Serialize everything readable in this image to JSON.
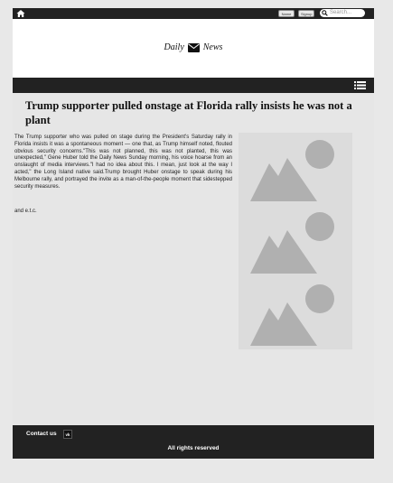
{
  "topbar": {
    "button1_label": "Name",
    "button2_label": "Signup",
    "search_placeholder": "Search...",
    "icons": [
      "home-icon",
      "search-icon"
    ]
  },
  "brand": {
    "left": "Daily",
    "right": "News",
    "icon": "mail-icon"
  },
  "navbar": {
    "icon": "menu-list-icon"
  },
  "article": {
    "headline": "Trump supporter pulled onstage at Florida rally insists he was not a plant",
    "body": "The Trump supporter who was pulled on stage during the President's Saturday rally in Florida insists it was a spontaneous moment — one that, as Trump himself noted, flouted obvious security concerns.\"This was not planned, this was not planted, this was unexpected,\" Gene Huber told the Daily News Sunday morning, his voice hoarse from an onslaught of media interviews.\"I had no idea about this. I mean, just look at the way I acted,\" the Long Island native said.Trump brought Huber onstage to speak during his Melbourne rally, and portrayed the invite as a man-of-the-people moment that sidestepped security measures.",
    "tail": "and e.t.c.",
    "images": [
      "image-placeholder-icon",
      "image-placeholder-icon",
      "image-placeholder-icon"
    ]
  },
  "footer": {
    "contact_label": "Contact us",
    "social_icon": "vk-icon",
    "rights": "All rights reserved"
  },
  "colors": {
    "dark_bar": "#222222",
    "background": "#e6e6e6",
    "placeholder": "#b0b0b0"
  }
}
